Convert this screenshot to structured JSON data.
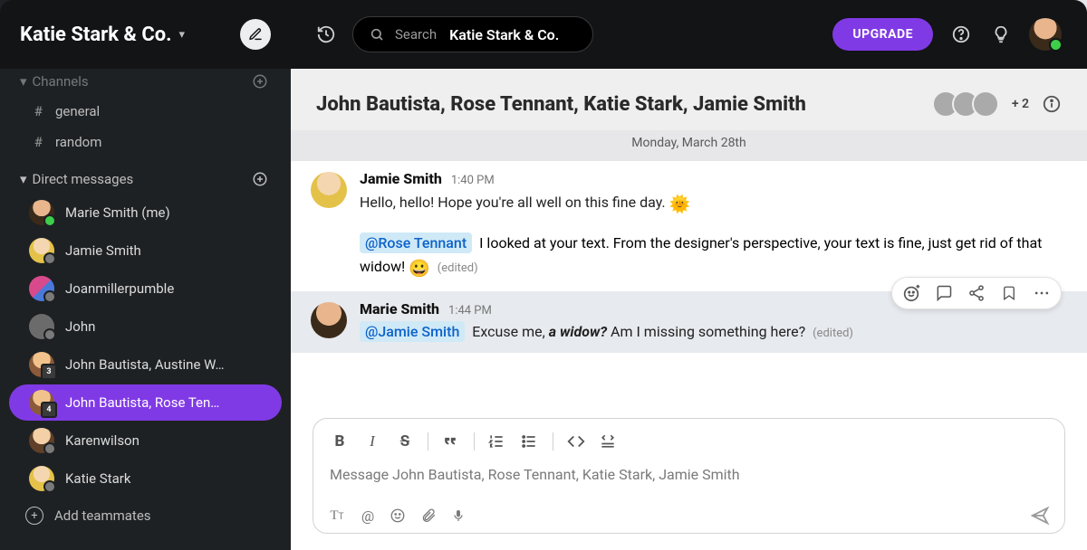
{
  "workspace": {
    "title": "Katie Stark & Co."
  },
  "sidebar": {
    "channels_label": "Channels",
    "channels": [
      {
        "name": "general"
      },
      {
        "name": "random"
      }
    ],
    "dm_label": "Direct messages",
    "dms": [
      {
        "name": "Marie Smith (me)",
        "online": true
      },
      {
        "name": "Jamie Smith"
      },
      {
        "name": "Joanmillerpumble"
      },
      {
        "name": "John"
      },
      {
        "name": "John Bautista, Austine W…",
        "badge": "3"
      },
      {
        "name": "John Bautista, Rose Ten…",
        "badge": "4",
        "active": true
      },
      {
        "name": "Karenwilson"
      },
      {
        "name": "Katie Stark"
      }
    ],
    "add_teammates": "Add teammates"
  },
  "topbar": {
    "search_label": "Search",
    "search_scope": "Katie Stark & Co.",
    "upgrade": "UPGRADE"
  },
  "channel_header": {
    "title": "John Bautista, Rose Tennant, Katie Stark, Jamie Smith",
    "more_count": "+ 2"
  },
  "date_separator": "Monday, March 28th",
  "messages": [
    {
      "author": "Jamie Smith",
      "time": "1:40 PM",
      "text": "Hello, hello! Hope you're all well on this fine day.",
      "emoji": "🌞",
      "continuation": {
        "mention": "@Rose Tennant",
        "text_after_mention": "I looked at your text. From the designer's perspective, your text is fine, just get rid of that widow!",
        "emoji": "😀",
        "edited": "(edited)"
      }
    },
    {
      "author": "Marie Smith",
      "time": "1:44 PM",
      "mention": "@Jamie Smith",
      "pre_text": "Excuse me, ",
      "italic_bold": "a widow?",
      "post_text": " Am I missing something here?",
      "edited": "(edited)"
    }
  ],
  "composer": {
    "placeholder": "Message John Bautista, Rose Tennant, Katie Stark, Jamie Smith"
  },
  "icons": {
    "bold": "B",
    "italic": "I",
    "strike": "S",
    "quote": "❝❞",
    "ol": "≡",
    "ul": "•≡",
    "code": "</>",
    "codeblock": "⌘"
  }
}
